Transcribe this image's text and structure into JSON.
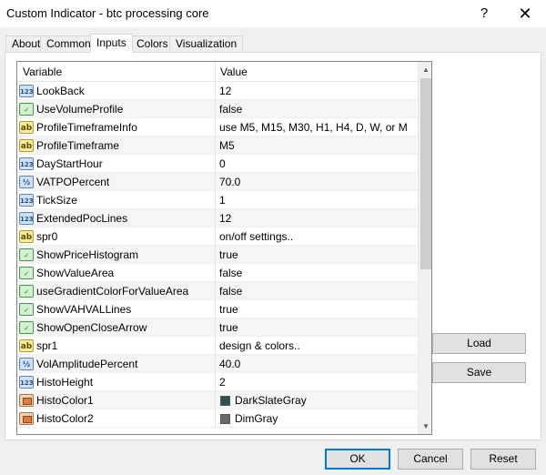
{
  "window": {
    "title": "Custom Indicator - btc processing core",
    "help_symbol": "?",
    "close_symbol": "✕"
  },
  "tabs": [
    {
      "label": "About"
    },
    {
      "label": "Common"
    },
    {
      "label": "Inputs"
    },
    {
      "label": "Colors"
    },
    {
      "label": "Visualization"
    }
  ],
  "active_tab": "Inputs",
  "grid": {
    "columns": {
      "variable": "Variable",
      "value": "Value"
    },
    "rows": [
      {
        "type": "int",
        "name": "LookBack",
        "value": "12"
      },
      {
        "type": "bool",
        "name": "UseVolumeProfile",
        "value": "false"
      },
      {
        "type": "str",
        "name": "ProfileTimeframeInfo",
        "value": "use M5, M15, M30, H1, H4, D, W, or M"
      },
      {
        "type": "str",
        "name": "ProfileTimeframe",
        "value": "M5"
      },
      {
        "type": "int",
        "name": "DayStartHour",
        "value": "0"
      },
      {
        "type": "dbl",
        "name": "VATPOPercent",
        "value": "70.0"
      },
      {
        "type": "int",
        "name": "TickSize",
        "value": "1"
      },
      {
        "type": "int",
        "name": "ExtendedPocLines",
        "value": "12"
      },
      {
        "type": "str",
        "name": "spr0",
        "value": "on/off settings.."
      },
      {
        "type": "bool",
        "name": "ShowPriceHistogram",
        "value": "true"
      },
      {
        "type": "bool",
        "name": "ShowValueArea",
        "value": "false"
      },
      {
        "type": "bool",
        "name": "useGradientColorForValueArea",
        "value": "false"
      },
      {
        "type": "bool",
        "name": "ShowVAHVALLines",
        "value": "true"
      },
      {
        "type": "bool",
        "name": "ShowOpenCloseArrow",
        "value": "true"
      },
      {
        "type": "str",
        "name": "spr1",
        "value": "design & colors.."
      },
      {
        "type": "dbl",
        "name": "VolAmplitudePercent",
        "value": "40.0"
      },
      {
        "type": "int",
        "name": "HistoHeight",
        "value": "2"
      },
      {
        "type": "color",
        "name": "HistoColor1",
        "value": "DarkSlateGray",
        "swatch": "#2f4f4f"
      },
      {
        "type": "color",
        "name": "HistoColor2",
        "value": "DimGray",
        "swatch": "#696969"
      }
    ]
  },
  "icons": {
    "int": "123",
    "dbl": "½",
    "str": "ab",
    "bool": "✓",
    "color": ""
  },
  "buttons": {
    "load": "Load",
    "save": "Save",
    "ok": "OK",
    "cancel": "Cancel",
    "reset": "Reset"
  }
}
